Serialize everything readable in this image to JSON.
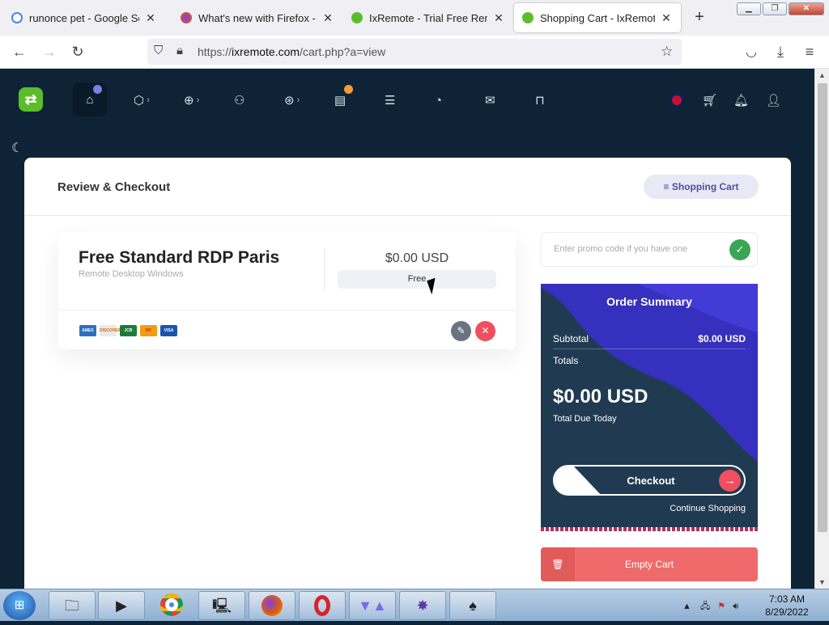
{
  "browser": {
    "tabs": [
      {
        "title": "runonce pet - Google Search",
        "favicon_color": "#4285f4"
      },
      {
        "title": "What's new with Firefox - Mo",
        "favicon_color": "#e66000"
      },
      {
        "title": "IxRemote - Trial Free Remote",
        "favicon_color": "#5cbd2c"
      },
      {
        "title": "Shopping Cart - IxRemote - T",
        "favicon_color": "#5cbd2c"
      }
    ],
    "new_tab": "+",
    "url_prefix": "https://",
    "url_domain": "ixremote.com",
    "url_path": "/cart.php?a=view"
  },
  "site_nav": {
    "logo_glyph": "⇄",
    "items": [
      "home-icon",
      "box-icon",
      "globe-icon",
      "user-plus-icon",
      "lifebuoy-icon",
      "document-icon",
      "server-icon",
      "chart-icon",
      "mail-icon",
      "lock-icon"
    ],
    "right_items": [
      "flag-icon",
      "cart-icon",
      "bell-icon",
      "user-icon"
    ],
    "dot_colors": {
      "home": "#7b7fe8",
      "document": "#f29c3b"
    }
  },
  "page": {
    "title": "Review & Checkout",
    "shopping_cart_button": "Shopping Cart"
  },
  "cart_item": {
    "name": "Free Standard RDP Paris",
    "description": "Remote Desktop Windows",
    "price": "$0.00 USD",
    "billing_cycle": "Free",
    "payment_methods": [
      "AMEX",
      "DISCOVER",
      "JCB",
      "MC",
      "VISA"
    ]
  },
  "promo": {
    "placeholder": "Enter promo code if you have one"
  },
  "order_summary": {
    "title": "Order Summary",
    "subtotal_label": "Subtotal",
    "subtotal_value": "$0.00 USD",
    "totals_label": "Totals",
    "total_amount": "$0.00 USD",
    "total_due_label": "Total Due Today",
    "checkout_label": "Checkout",
    "continue_label": "Continue Shopping"
  },
  "empty_cart_label": "Empty Cart",
  "taskbar": {
    "time": "7:03 AM",
    "date": "8/29/2022"
  },
  "colors": {
    "accent_green": "#5cbd2c",
    "page_bg": "#0f2336",
    "danger": "#ef6b6b",
    "summary_bg": "#203a52",
    "summary_wave": "#3a2fd0"
  }
}
